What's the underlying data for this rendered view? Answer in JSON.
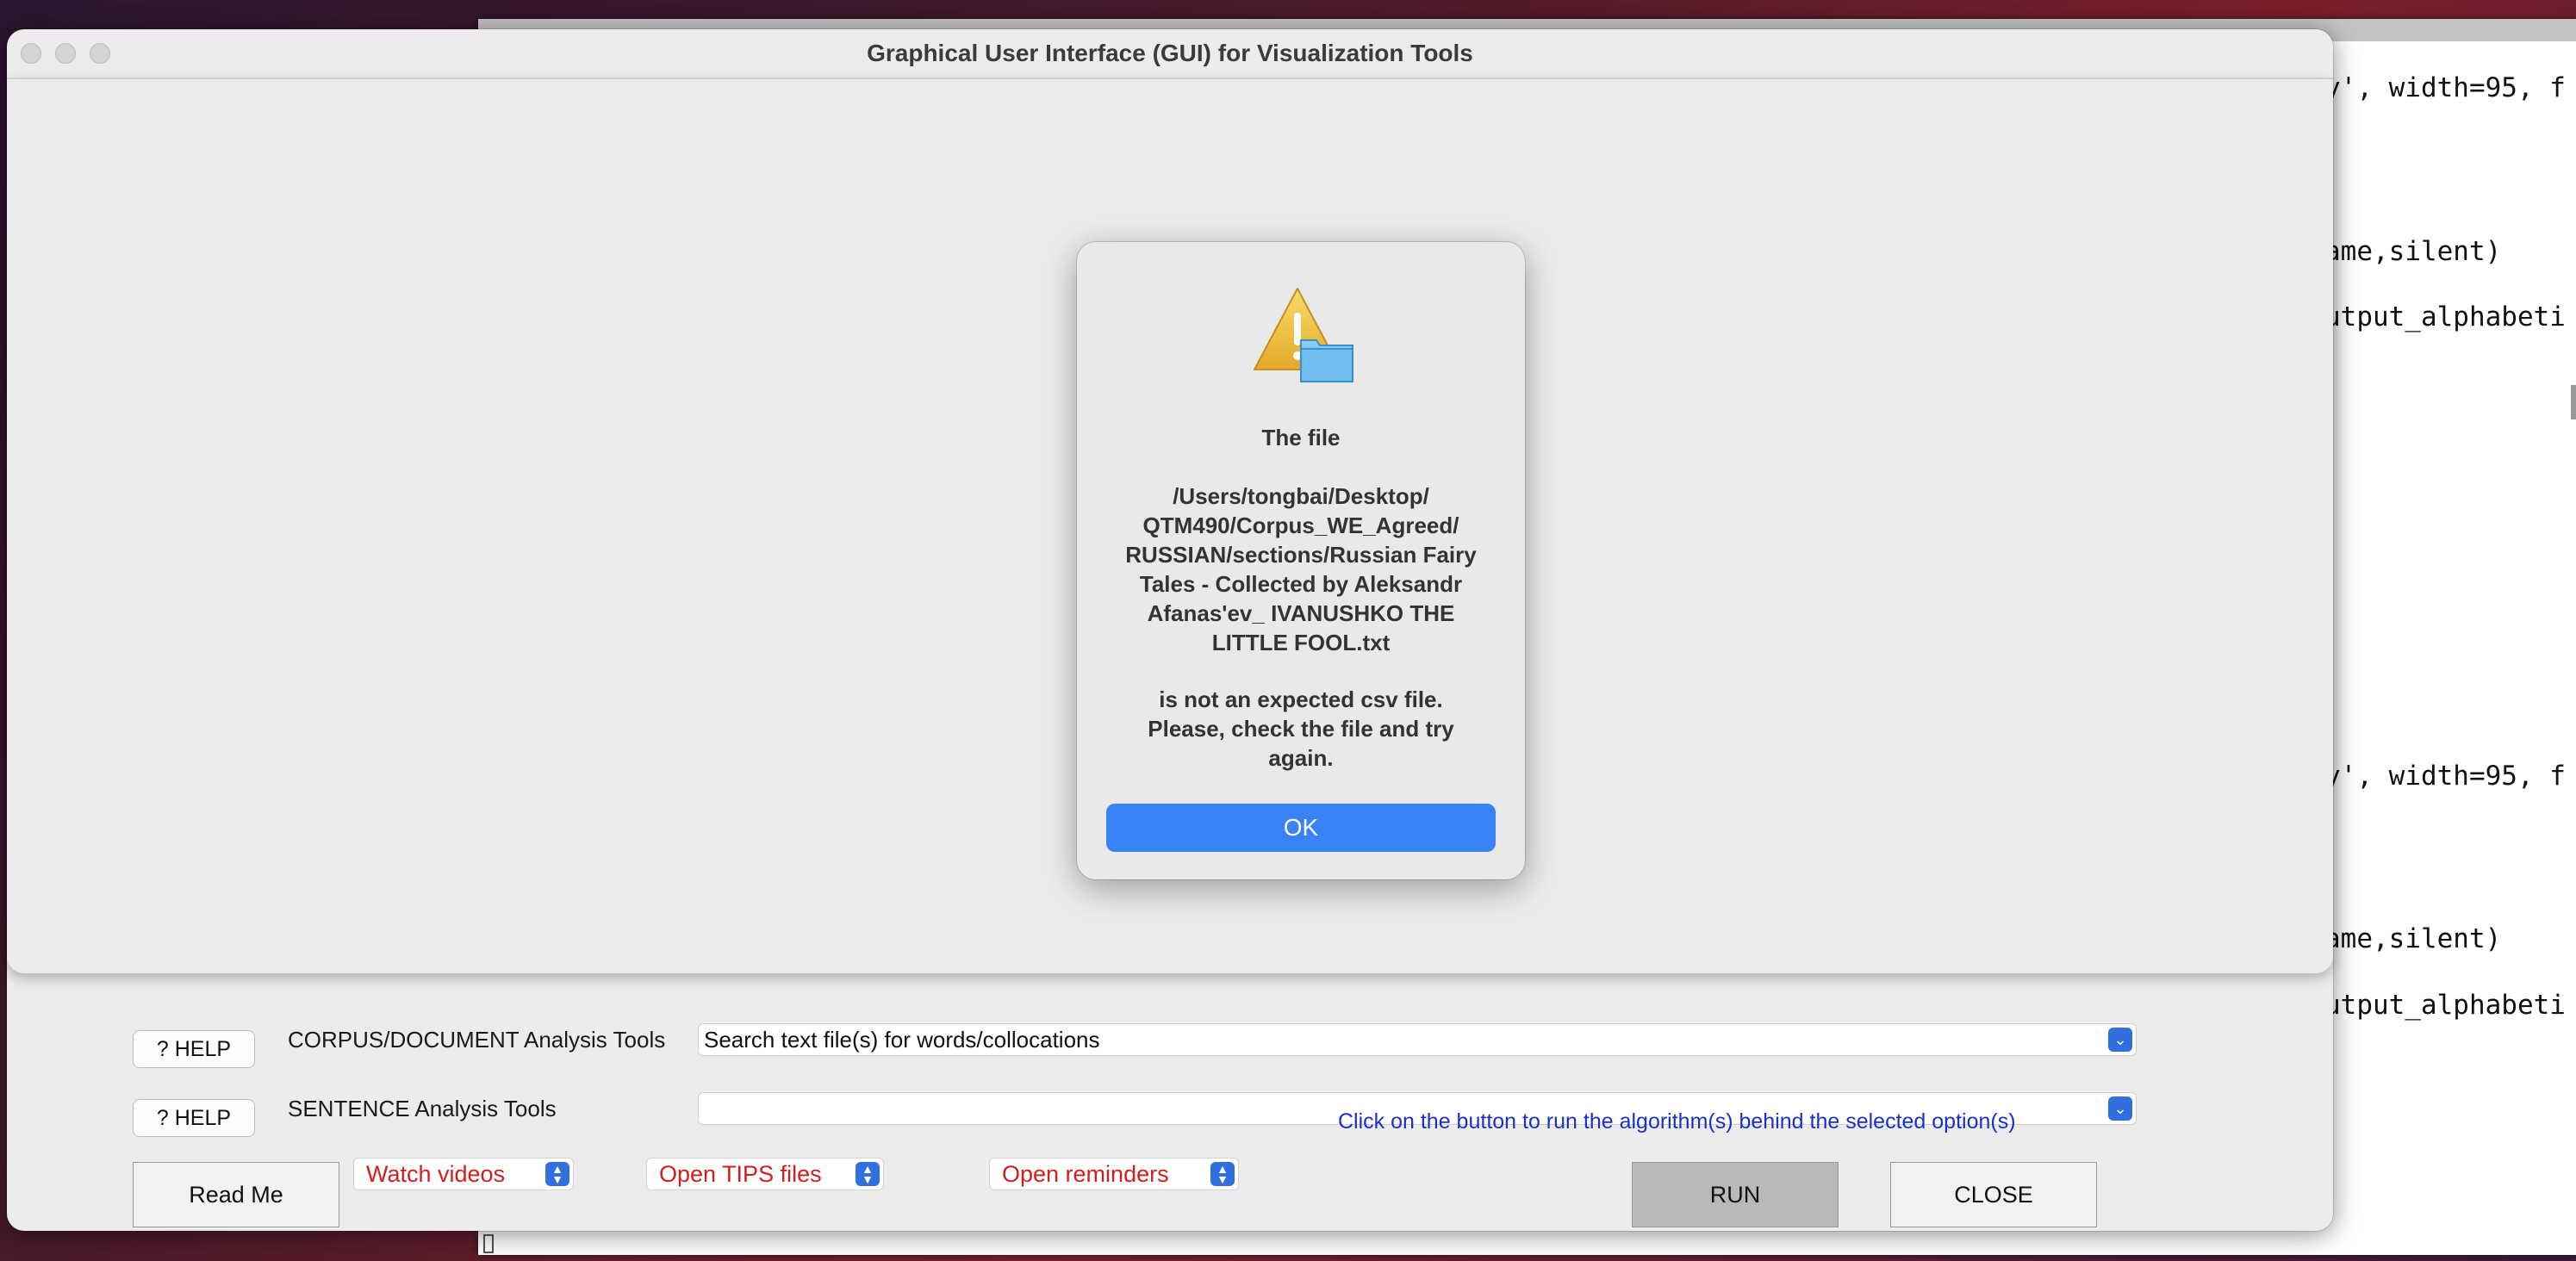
{
  "editor": {
    "code_lines": [
      "y', width=95, f",
      "ame,silent)",
      "utput_alphabeti",
      "y', width=95, f",
      "ame,silent)",
      "utput_alphabeti"
    ]
  },
  "window": {
    "title": "Graphical User Interface (GUI) for Visualization Tools"
  },
  "alert": {
    "icon": "warning-folder-icon",
    "heading": "The file",
    "path": "/Users/tongbai/Desktop/\nQTM490/Corpus_WE_Agreed/\nRUSSIAN/sections/Russian Fairy\nTales - Collected by Aleksandr\nAfanas'ev_ IVANUSHKO THE\nLITTLE FOOL.txt",
    "message": "is not an expected csv file.\nPlease, check the file and try\nagain.",
    "ok_label": "OK",
    "ok_color": "#3a82f7"
  },
  "panel": {
    "corpus_row": {
      "help_label": "? HELP",
      "label": "CORPUS/DOCUMENT Analysis Tools",
      "selected": "Search text file(s) for words/collocations"
    },
    "sentence_row": {
      "help_label": "? HELP",
      "label": "SENTENCE Analysis Tools",
      "selected": ""
    },
    "hint": "Click on the button to run the algorithm(s) behind the selected option(s)",
    "read_me_label": "Read Me",
    "videos_selected": "Watch videos",
    "tips_selected": "Open TIPS files",
    "reminders_selected": "Open reminders",
    "run_label": "RUN",
    "close_label": "CLOSE"
  }
}
